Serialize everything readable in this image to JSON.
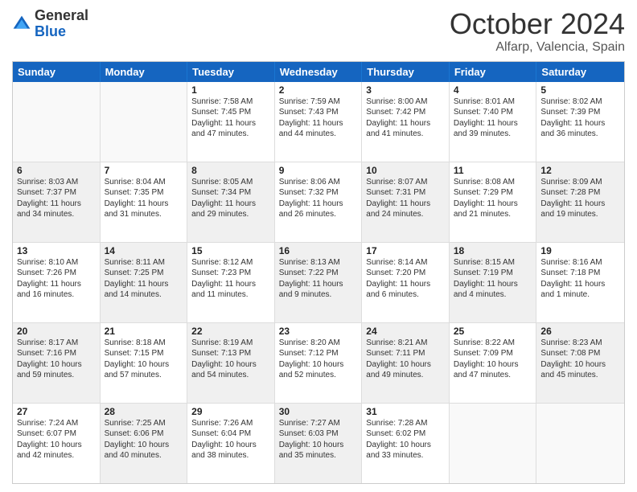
{
  "logo": {
    "general": "General",
    "blue": "Blue"
  },
  "header": {
    "month": "October 2024",
    "location": "Alfarp, Valencia, Spain"
  },
  "weekdays": [
    "Sunday",
    "Monday",
    "Tuesday",
    "Wednesday",
    "Thursday",
    "Friday",
    "Saturday"
  ],
  "rows": [
    [
      {
        "day": "",
        "empty": true
      },
      {
        "day": "",
        "empty": true
      },
      {
        "day": "1",
        "sunrise": "Sunrise: 7:58 AM",
        "sunset": "Sunset: 7:45 PM",
        "daylight": "Daylight: 11 hours and 47 minutes."
      },
      {
        "day": "2",
        "sunrise": "Sunrise: 7:59 AM",
        "sunset": "Sunset: 7:43 PM",
        "daylight": "Daylight: 11 hours and 44 minutes."
      },
      {
        "day": "3",
        "sunrise": "Sunrise: 8:00 AM",
        "sunset": "Sunset: 7:42 PM",
        "daylight": "Daylight: 11 hours and 41 minutes."
      },
      {
        "day": "4",
        "sunrise": "Sunrise: 8:01 AM",
        "sunset": "Sunset: 7:40 PM",
        "daylight": "Daylight: 11 hours and 39 minutes."
      },
      {
        "day": "5",
        "sunrise": "Sunrise: 8:02 AM",
        "sunset": "Sunset: 7:39 PM",
        "daylight": "Daylight: 11 hours and 36 minutes."
      }
    ],
    [
      {
        "day": "6",
        "sunrise": "Sunrise: 8:03 AM",
        "sunset": "Sunset: 7:37 PM",
        "daylight": "Daylight: 11 hours and 34 minutes.",
        "shaded": true
      },
      {
        "day": "7",
        "sunrise": "Sunrise: 8:04 AM",
        "sunset": "Sunset: 7:35 PM",
        "daylight": "Daylight: 11 hours and 31 minutes."
      },
      {
        "day": "8",
        "sunrise": "Sunrise: 8:05 AM",
        "sunset": "Sunset: 7:34 PM",
        "daylight": "Daylight: 11 hours and 29 minutes.",
        "shaded": true
      },
      {
        "day": "9",
        "sunrise": "Sunrise: 8:06 AM",
        "sunset": "Sunset: 7:32 PM",
        "daylight": "Daylight: 11 hours and 26 minutes."
      },
      {
        "day": "10",
        "sunrise": "Sunrise: 8:07 AM",
        "sunset": "Sunset: 7:31 PM",
        "daylight": "Daylight: 11 hours and 24 minutes.",
        "shaded": true
      },
      {
        "day": "11",
        "sunrise": "Sunrise: 8:08 AM",
        "sunset": "Sunset: 7:29 PM",
        "daylight": "Daylight: 11 hours and 21 minutes."
      },
      {
        "day": "12",
        "sunrise": "Sunrise: 8:09 AM",
        "sunset": "Sunset: 7:28 PM",
        "daylight": "Daylight: 11 hours and 19 minutes.",
        "shaded": true
      }
    ],
    [
      {
        "day": "13",
        "sunrise": "Sunrise: 8:10 AM",
        "sunset": "Sunset: 7:26 PM",
        "daylight": "Daylight: 11 hours and 16 minutes."
      },
      {
        "day": "14",
        "sunrise": "Sunrise: 8:11 AM",
        "sunset": "Sunset: 7:25 PM",
        "daylight": "Daylight: 11 hours and 14 minutes.",
        "shaded": true
      },
      {
        "day": "15",
        "sunrise": "Sunrise: 8:12 AM",
        "sunset": "Sunset: 7:23 PM",
        "daylight": "Daylight: 11 hours and 11 minutes."
      },
      {
        "day": "16",
        "sunrise": "Sunrise: 8:13 AM",
        "sunset": "Sunset: 7:22 PM",
        "daylight": "Daylight: 11 hours and 9 minutes.",
        "shaded": true
      },
      {
        "day": "17",
        "sunrise": "Sunrise: 8:14 AM",
        "sunset": "Sunset: 7:20 PM",
        "daylight": "Daylight: 11 hours and 6 minutes."
      },
      {
        "day": "18",
        "sunrise": "Sunrise: 8:15 AM",
        "sunset": "Sunset: 7:19 PM",
        "daylight": "Daylight: 11 hours and 4 minutes.",
        "shaded": true
      },
      {
        "day": "19",
        "sunrise": "Sunrise: 8:16 AM",
        "sunset": "Sunset: 7:18 PM",
        "daylight": "Daylight: 11 hours and 1 minute."
      }
    ],
    [
      {
        "day": "20",
        "sunrise": "Sunrise: 8:17 AM",
        "sunset": "Sunset: 7:16 PM",
        "daylight": "Daylight: 10 hours and 59 minutes.",
        "shaded": true
      },
      {
        "day": "21",
        "sunrise": "Sunrise: 8:18 AM",
        "sunset": "Sunset: 7:15 PM",
        "daylight": "Daylight: 10 hours and 57 minutes."
      },
      {
        "day": "22",
        "sunrise": "Sunrise: 8:19 AM",
        "sunset": "Sunset: 7:13 PM",
        "daylight": "Daylight: 10 hours and 54 minutes.",
        "shaded": true
      },
      {
        "day": "23",
        "sunrise": "Sunrise: 8:20 AM",
        "sunset": "Sunset: 7:12 PM",
        "daylight": "Daylight: 10 hours and 52 minutes."
      },
      {
        "day": "24",
        "sunrise": "Sunrise: 8:21 AM",
        "sunset": "Sunset: 7:11 PM",
        "daylight": "Daylight: 10 hours and 49 minutes.",
        "shaded": true
      },
      {
        "day": "25",
        "sunrise": "Sunrise: 8:22 AM",
        "sunset": "Sunset: 7:09 PM",
        "daylight": "Daylight: 10 hours and 47 minutes."
      },
      {
        "day": "26",
        "sunrise": "Sunrise: 8:23 AM",
        "sunset": "Sunset: 7:08 PM",
        "daylight": "Daylight: 10 hours and 45 minutes.",
        "shaded": true
      }
    ],
    [
      {
        "day": "27",
        "sunrise": "Sunrise: 7:24 AM",
        "sunset": "Sunset: 6:07 PM",
        "daylight": "Daylight: 10 hours and 42 minutes."
      },
      {
        "day": "28",
        "sunrise": "Sunrise: 7:25 AM",
        "sunset": "Sunset: 6:06 PM",
        "daylight": "Daylight: 10 hours and 40 minutes.",
        "shaded": true
      },
      {
        "day": "29",
        "sunrise": "Sunrise: 7:26 AM",
        "sunset": "Sunset: 6:04 PM",
        "daylight": "Daylight: 10 hours and 38 minutes."
      },
      {
        "day": "30",
        "sunrise": "Sunrise: 7:27 AM",
        "sunset": "Sunset: 6:03 PM",
        "daylight": "Daylight: 10 hours and 35 minutes.",
        "shaded": true
      },
      {
        "day": "31",
        "sunrise": "Sunrise: 7:28 AM",
        "sunset": "Sunset: 6:02 PM",
        "daylight": "Daylight: 10 hours and 33 minutes."
      },
      {
        "day": "",
        "empty": true
      },
      {
        "day": "",
        "empty": true
      }
    ]
  ]
}
